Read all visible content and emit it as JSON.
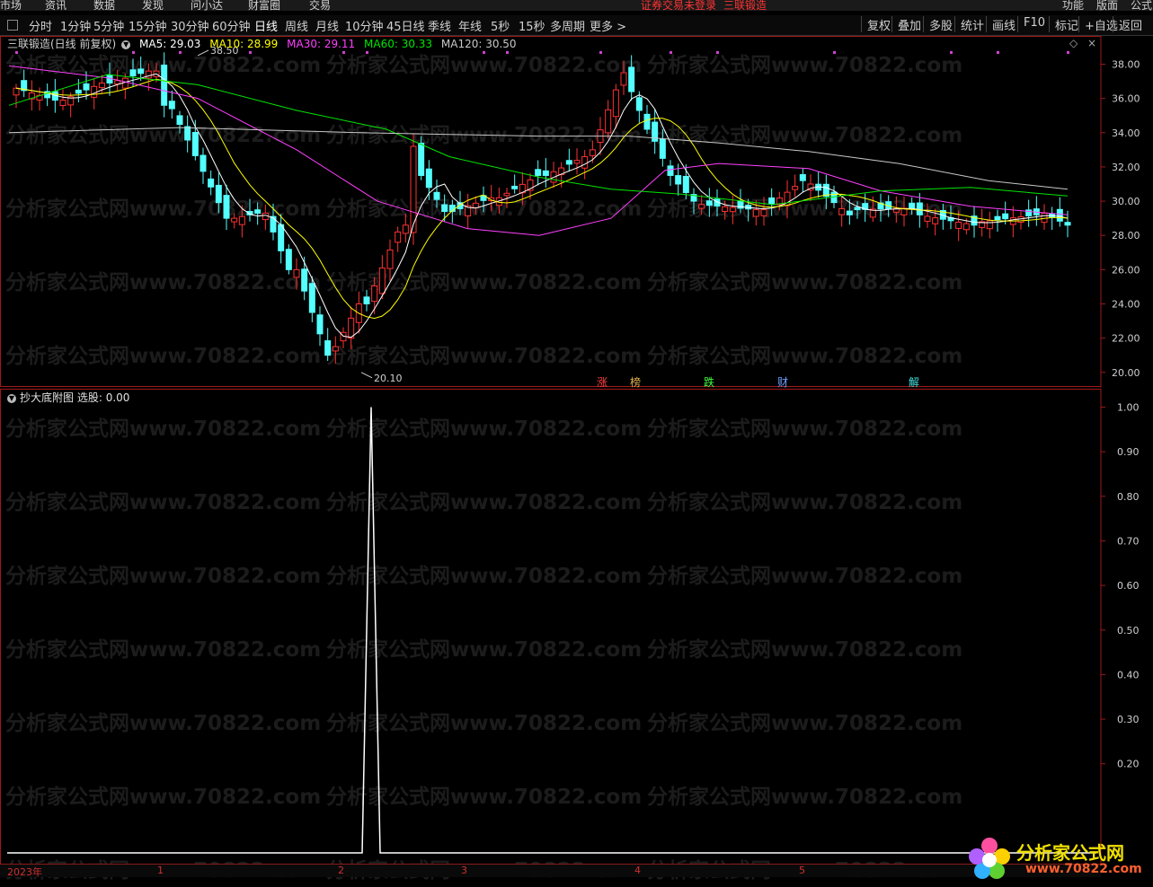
{
  "topbar": {
    "menu": [
      "市场",
      "资讯",
      "数据",
      "发现",
      "问小达",
      "财富圈",
      "交易"
    ],
    "alert": "证券交易未登录",
    "stock_name": "三联锻造",
    "right": [
      "功能",
      "版面",
      "公式"
    ]
  },
  "period_bar": {
    "items": [
      "分时",
      "1分钟",
      "5分钟",
      "15分钟",
      "30分钟",
      "60分钟",
      "日线",
      "周线",
      "月线",
      "10分钟",
      "45日线",
      "季线",
      "年线",
      "5秒",
      "15秒",
      "多周期",
      "更多 >"
    ],
    "active": "日线",
    "tools": [
      "复权",
      "叠加",
      "多股",
      "统计",
      "画线",
      "F10",
      "标记",
      "+自选",
      "返回"
    ]
  },
  "main_legend": {
    "title": "三联锻造(日线 前复权)",
    "ma5": "MA5: 29.03",
    "ma10": "MA10: 28.99",
    "ma30": "MA30: 29.11",
    "ma60": "MA60: 30.33",
    "ma120": "MA120: 30.50"
  },
  "annotations": {
    "high": "38.50",
    "low": "20.10"
  },
  "event_tags": [
    {
      "text": "涨",
      "color": "#ff4040"
    },
    {
      "text": "榜",
      "color": "#e0b050"
    },
    {
      "text": "跌",
      "color": "#40ff40"
    },
    {
      "text": "财",
      "color": "#6fa0ff"
    },
    {
      "text": "解",
      "color": "#40e0e0"
    }
  ],
  "price_axis": [
    "38.00",
    "36.00",
    "34.00",
    "32.00",
    "30.00",
    "28.00",
    "26.00",
    "24.00",
    "22.00",
    "20.00"
  ],
  "sub_legend": {
    "title": "抄大底附图",
    "value": "选股: 0.00"
  },
  "sub_axis": [
    "1.00",
    "0.90",
    "0.80",
    "0.70",
    "0.60",
    "0.50",
    "0.40",
    "0.30",
    "0.20"
  ],
  "date_axis": [
    "2023年",
    "1",
    "2",
    "3",
    "4",
    "5"
  ],
  "watermark": "分析家公式网www.70822.com",
  "logo": {
    "text": "分析家公式网",
    "url": "www.70822.com"
  },
  "colors": {
    "up": "#ff3232",
    "down": "#54ffff",
    "ma5": "#ffffff",
    "ma10": "#ffff00",
    "ma30": "#ff40ff",
    "ma60": "#00e600",
    "ma120": "#c8c8c8",
    "border": "#a01818"
  }
}
